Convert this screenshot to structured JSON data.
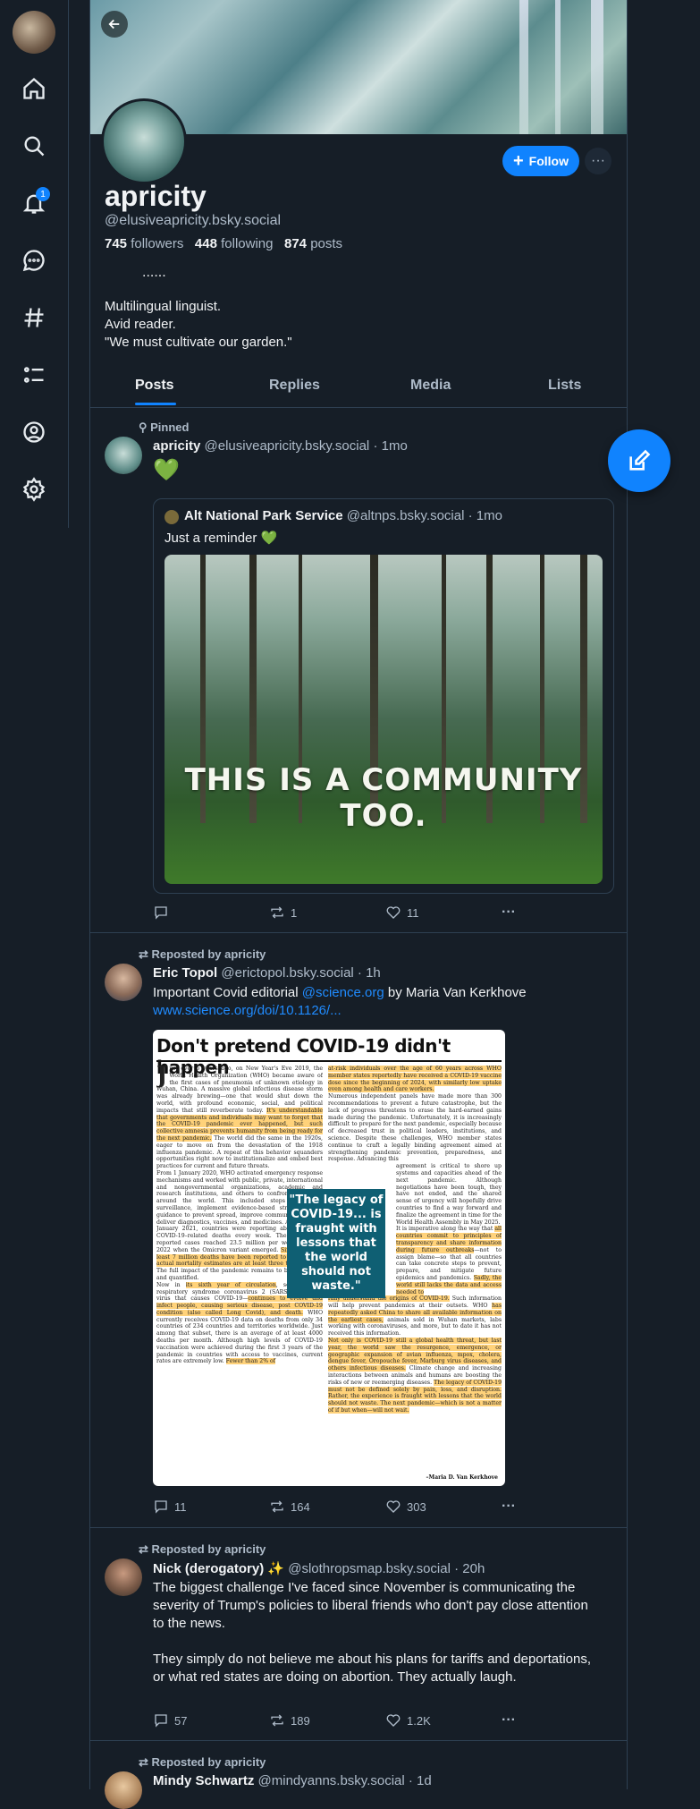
{
  "nav": {
    "notifications_badge": "1",
    "icons": [
      "home-icon",
      "search-icon",
      "bell-icon",
      "chat-icon",
      "hashtag-icon",
      "list-icon",
      "profile-icon",
      "settings-icon"
    ]
  },
  "profile": {
    "display_name": "apricity",
    "handle": "@elusiveapricity.bsky.social",
    "followers_count": "745",
    "followers_label": "followers",
    "following_count": "448",
    "following_label": "following",
    "posts_count": "874",
    "posts_label": "posts",
    "dots": "......",
    "bio": "Multilingual linguist.\nAvid reader.\n\"We must cultivate our garden.\"",
    "follow_label": "Follow",
    "more_label": "···"
  },
  "tabs": [
    "Posts",
    "Replies",
    "Media",
    "Lists"
  ],
  "posts": [
    {
      "context": "Pinned",
      "name": "apricity",
      "handle": "@elusiveapricity.bsky.social",
      "time": "· 1mo",
      "text": "💚",
      "quote": {
        "name": "Alt National Park Service",
        "handle": "@altnps.bsky.social",
        "time": "· 1mo",
        "text": "Just a reminder 💚",
        "image_caption": "THIS IS A COMMUNITY TOO."
      },
      "replies": "",
      "reposts": "1",
      "likes": "11"
    },
    {
      "context": "Reposted by apricity",
      "name": "Eric Topol",
      "handle": "@erictopol.bsky.social",
      "time": "· 1h",
      "text_before": "Important Covid editorial ",
      "mention": "@science.org",
      "text_after": " by Maria Van Kerkhove",
      "url": "www.science.org/doi/10.1126/...",
      "article_title": "Don't pretend COVID-19 didn't happen",
      "pull_quote": "\"The legacy of COVID-19... is fraught with lessons that the world should not waste.\"",
      "signature": "–Maria D. Van Kerkhove",
      "replies": "11",
      "reposts": "164",
      "likes": "303"
    },
    {
      "context": "Reposted by apricity",
      "name": "Nick (derogatory)",
      "badge": "✨",
      "handle": "@slothropsmap.bsky.social",
      "time": "· 20h",
      "text": "The biggest challenge I've faced since November is communicating the severity of Trump's policies to liberal friends who don't pay close attention to the news.\n\nThey simply do not believe me about his plans for tariffs and deportations, or what red states are doing on abortion. They actually laugh.",
      "replies": "57",
      "reposts": "189",
      "likes": "1.2K"
    },
    {
      "context": "Reposted by apricity",
      "name": "Mindy Schwartz",
      "handle": "@mindyanns.bsky.social",
      "time": "· 1d"
    }
  ],
  "colors": {
    "accent": "#1083fe",
    "background": "#161e27",
    "border": "#2e4052",
    "muted": "#aebbc9"
  }
}
